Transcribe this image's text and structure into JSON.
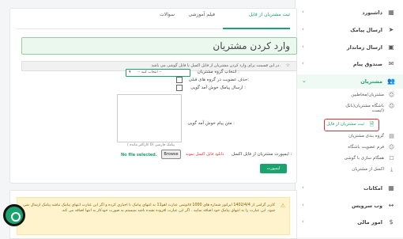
{
  "sidebar": {
    "items": [
      {
        "label": "داشبورد",
        "icon": "dashboard-icon",
        "glyph": "▦"
      },
      {
        "label": "ارسال پیامک",
        "icon": "send-sms-icon",
        "glyph": "➤"
      },
      {
        "label": "ارسال زماندار",
        "icon": "calendar-icon",
        "glyph": "▣"
      },
      {
        "label": "صندوق پیام",
        "icon": "inbox-icon",
        "glyph": "✉"
      },
      {
        "label": "مشتریان",
        "icon": "customers-icon",
        "glyph": "👥"
      }
    ],
    "subitems": [
      {
        "label": "مشتریان/مخاطبین",
        "icon": "contacts-icon",
        "glyph": "☺"
      },
      {
        "label": "باشگاه مشتریان(بانک",
        "icon": "club-icon",
        "glyph": "☺"
      },
      {
        "label": "ثبت مشتریان از فایل",
        "icon": "file-icon",
        "glyph": "🗎"
      },
      {
        "label": "گروه بندی مشتریان",
        "icon": "groups-icon",
        "glyph": "▤"
      },
      {
        "label": "فرم عضویت باشگاه",
        "icon": "form-icon",
        "glyph": "☺"
      },
      {
        "label": "همگام سازی با گوشی",
        "icon": "sync-icon",
        "glyph": "☐"
      },
      {
        "label": "اکسل از مشتریان",
        "icon": "excel-icon",
        "glyph": "⤓"
      }
    ],
    "subitem_extra": "ایست)",
    "bottom_items": [
      {
        "label": "امکانات",
        "icon": "features-icon",
        "glyph": "▦"
      },
      {
        "label": "وب سرویس",
        "icon": "webservice-icon",
        "glyph": "↔"
      },
      {
        "label": "امور مالی",
        "icon": "finance-icon",
        "glyph": "$"
      }
    ],
    "chevron_glyph": "‹",
    "chevron_open_glyph": "⌄"
  },
  "tabs": [
    "ثبت مشتریان از فایل",
    "فیلم آموزشی",
    "سوالات"
  ],
  "page": {
    "title": "وارد کردن مشتریان",
    "info": "در این قسمت برای وارد کردن مشتریان از فایل اکسل یا فایل گوشی می باشد.",
    "info_icon": "☆"
  },
  "form": {
    "group_label": "انتخاب گروه مشتریان :",
    "group_select_value": "-- انتخاب کنید --",
    "select_arrow": "▾",
    "remove_members_label": "حذف عضویت در گروه های قبلی:",
    "welcome_sms_label": "ارسال پیامک خوش آمد گویی :",
    "welcome_text_label": "متن پیام خوش آمد گویی :",
    "counter": "پیامک فارسی (0 کاراکتر مانده )",
    "import_label": "ایمپورت مشتریان از فایل اکسل :",
    "download_link": "دانلود فایل اکسل نمونه",
    "browse": "Browse",
    "no_file": "No file selected.",
    "import_button": "ایمپورت",
    "emoji_glyph": "☺"
  },
  "notice": {
    "text": "کاربر گرامی از 1402/4/4 اپراتور شماره های 1000 قانونمن عبارت لغو11 به انتهای پیامک با اجباری کرده و اگر این عبارت انتهای پیامک نباشد پیامک ارسال نمی شود. این عبارت را به انتهای پیامک خود اضافه نمایید . اگر این عبارت افزوده نشده باشد سیستم به صورت خودکار به انتها اضافه می کند.",
    "icon_glyph": "⚠"
  },
  "colors": {
    "accent": "#1aa36f",
    "danger": "#e03131",
    "warning_bg": "#fff3cd"
  }
}
